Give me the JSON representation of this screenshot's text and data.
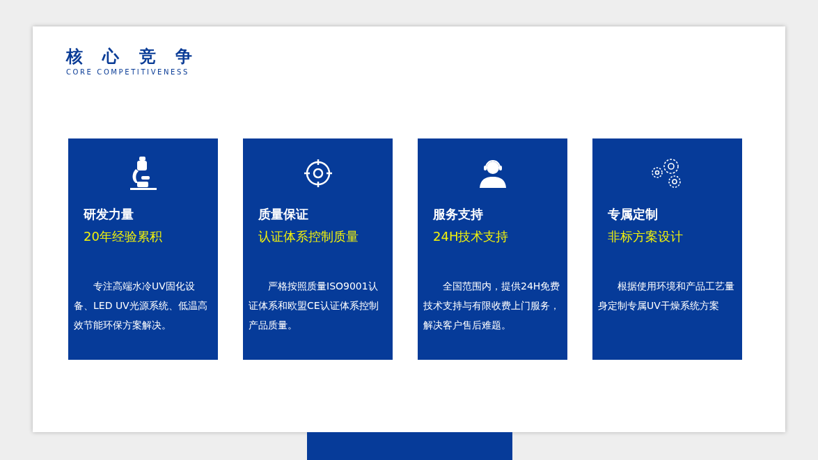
{
  "header": {
    "title": "核 心 竞 争",
    "subtitle": "CORE COMPETITIVENESS"
  },
  "cards": [
    {
      "kind": "microscope",
      "heading": "研发力量",
      "highlight": "20年经验累积",
      "description": "专注高端水冷UV固化设备、LED UV光源系统、低温高效节能环保方案解决。"
    },
    {
      "kind": "target",
      "heading": "质量保证",
      "highlight": "认证体系控制质量",
      "description": "严格按照质量ISO9001认证体系和欧盟CE认证体系控制产品质量。"
    },
    {
      "kind": "headset",
      "heading": "服务支持",
      "highlight": "24H技术支持",
      "description": "全国范围内，提供24H免费技术支持与有限收费上门服务，解决客户售后难题。"
    },
    {
      "kind": "gears",
      "heading": "专属定制",
      "highlight": "非标方案设计",
      "description": "根据使用环境和产品工艺量身定制专属UV干燥系统方案"
    }
  ]
}
